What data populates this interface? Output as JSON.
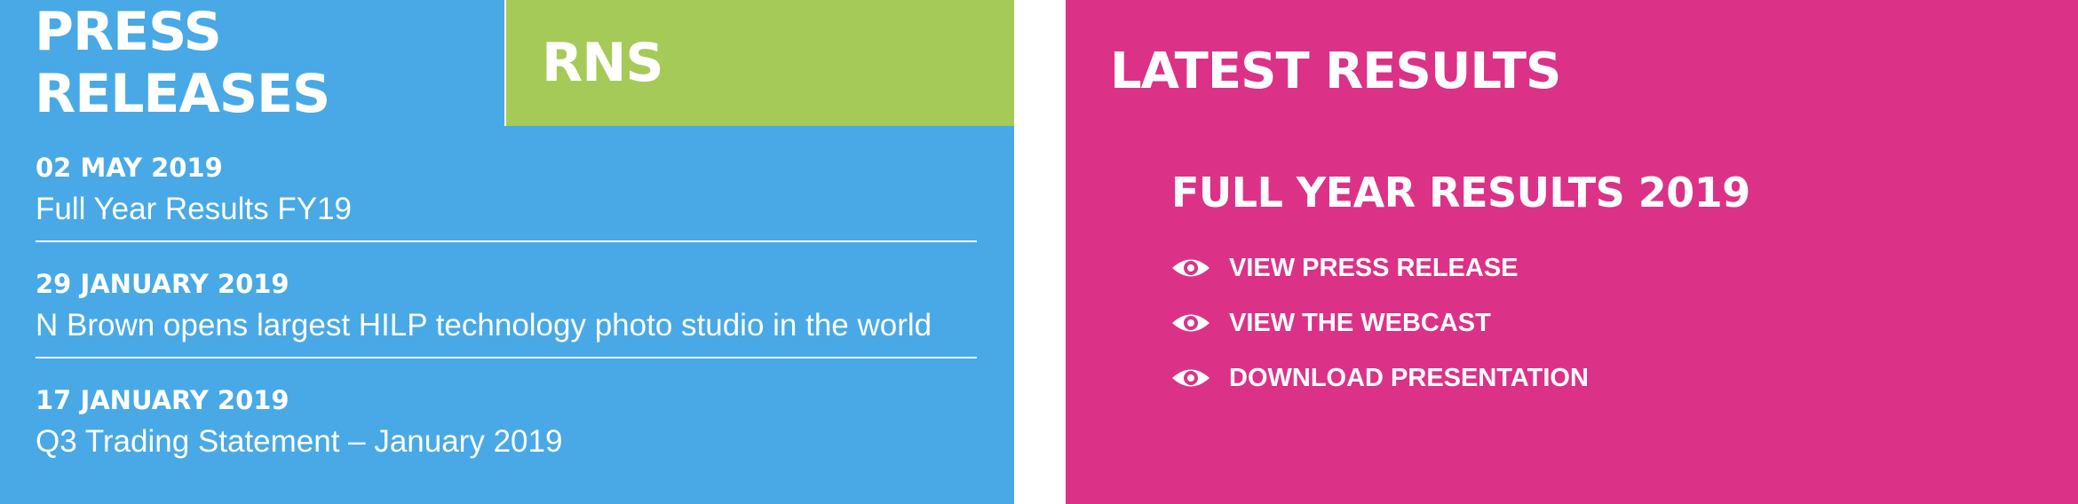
{
  "press_panel": {
    "tabs": [
      {
        "label": "PRESS RELEASES"
      },
      {
        "label": "RNS"
      }
    ],
    "items": [
      {
        "date": "02 MAY 2019",
        "title": "Full Year Results FY19"
      },
      {
        "date": "29 JANUARY 2019",
        "title": "N Brown opens largest HILP technology photo studio in the world"
      },
      {
        "date": "17 JANUARY 2019",
        "title": "Q3 Trading Statement – January 2019"
      }
    ],
    "colors": {
      "active_tab": "#48a9e6",
      "rns_tab": "#a6ca57"
    }
  },
  "results_panel": {
    "heading": "LATEST RESULTS",
    "subheading": "FULL YEAR RESULTS 2019",
    "links": [
      {
        "icon": "eye-icon",
        "label": "VIEW PRESS RELEASE"
      },
      {
        "icon": "eye-icon",
        "label": "VIEW THE WEBCAST"
      },
      {
        "icon": "eye-icon",
        "label": "DOWNLOAD PRESENTATION"
      }
    ],
    "colors": {
      "background": "#db3287"
    }
  }
}
